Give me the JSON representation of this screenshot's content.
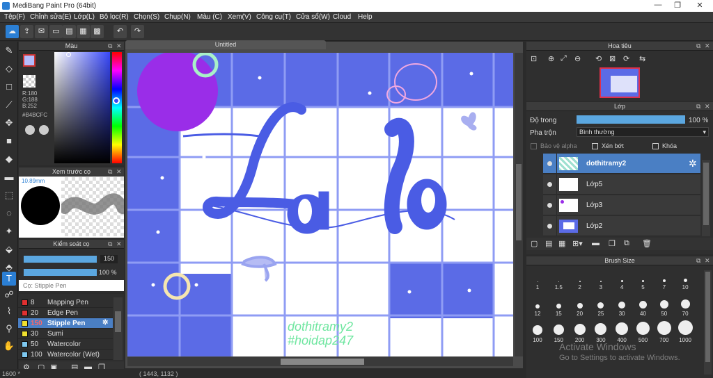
{
  "window": {
    "title": "MediBang Paint Pro (64bit)",
    "minimize": "—",
    "restore": "❐",
    "close": "✕"
  },
  "menu": [
    "Tệp(F)",
    "Chỉnh sửa(E)",
    "Lớp(L)",
    "Bộ lọc(R)",
    "Chọn(S)",
    "Chụp(N)",
    "Màu (C)",
    "Xem(V)",
    "Công cụ(T)",
    "Cửa sổ(W)",
    "Cloud",
    "Help"
  ],
  "color_panel": {
    "title": "Màu",
    "r": "R:180",
    "g": "G:188",
    "b": "B:252",
    "hex": "#B4BCFC",
    "fg_color": "#B4BCFC"
  },
  "brush_preview": {
    "title": "Xem trước cọ",
    "size": "10.89mm"
  },
  "brush_control": {
    "title": "Kiểm soát cọ",
    "size_value": "150",
    "opacity_value": "100 %",
    "current_brush": "Cọ: Stipple Pen"
  },
  "brushes": [
    {
      "size": "8",
      "name": "Mapping Pen",
      "color": "#e03030"
    },
    {
      "size": "20",
      "name": "Edge Pen",
      "color": "#e03030"
    },
    {
      "size": "150",
      "name": "Stipple Pen",
      "color": "#f0e030",
      "selected": true
    },
    {
      "size": "30",
      "name": "Sumi",
      "color": "#f0e030"
    },
    {
      "size": "50",
      "name": "Watercolor",
      "color": "#7ec8f0"
    },
    {
      "size": "100",
      "name": "Watercolor (Wet)",
      "color": "#7ec8f0"
    }
  ],
  "canvas": {
    "tab_title": "Untitled",
    "sig1": "dothitramy2",
    "sig2": "#hoidap247",
    "coords": "( 1443, 1132 )",
    "zoom": "1600 *"
  },
  "navigator": {
    "title": "Hoa tiêu"
  },
  "layers": {
    "title": "Lớp",
    "opacity_label": "Độ trong",
    "opacity_value": "100 %",
    "opacity_fraction": 1.0,
    "blend_label": "Pha trộn",
    "blend_value": "Bình thường",
    "protect_alpha": "Bảo vệ alpha",
    "clip": "Xén bớt",
    "lock": "Khóa",
    "items": [
      {
        "name": "dothitramy2",
        "selected": true
      },
      {
        "name": "Lớp5"
      },
      {
        "name": "Lớp3"
      },
      {
        "name": "Lớp2"
      }
    ]
  },
  "brush_size": {
    "title": "Brush Size",
    "row1": [
      "1",
      "1.5",
      "2",
      "3",
      "4",
      "5",
      "7",
      "10"
    ],
    "row2": [
      "12",
      "15",
      "20",
      "25",
      "30",
      "40",
      "50",
      "70"
    ],
    "row3": [
      "100",
      "150",
      "200",
      "300",
      "400",
      "500",
      "700",
      "1000"
    ]
  },
  "watermark": {
    "line1": "Activate Windows",
    "line2": "Go to Settings to activate Windows."
  },
  "colors": {
    "accent": "#5b6be6",
    "selection": "#4a7fc4",
    "panel": "#2e2e2e"
  }
}
